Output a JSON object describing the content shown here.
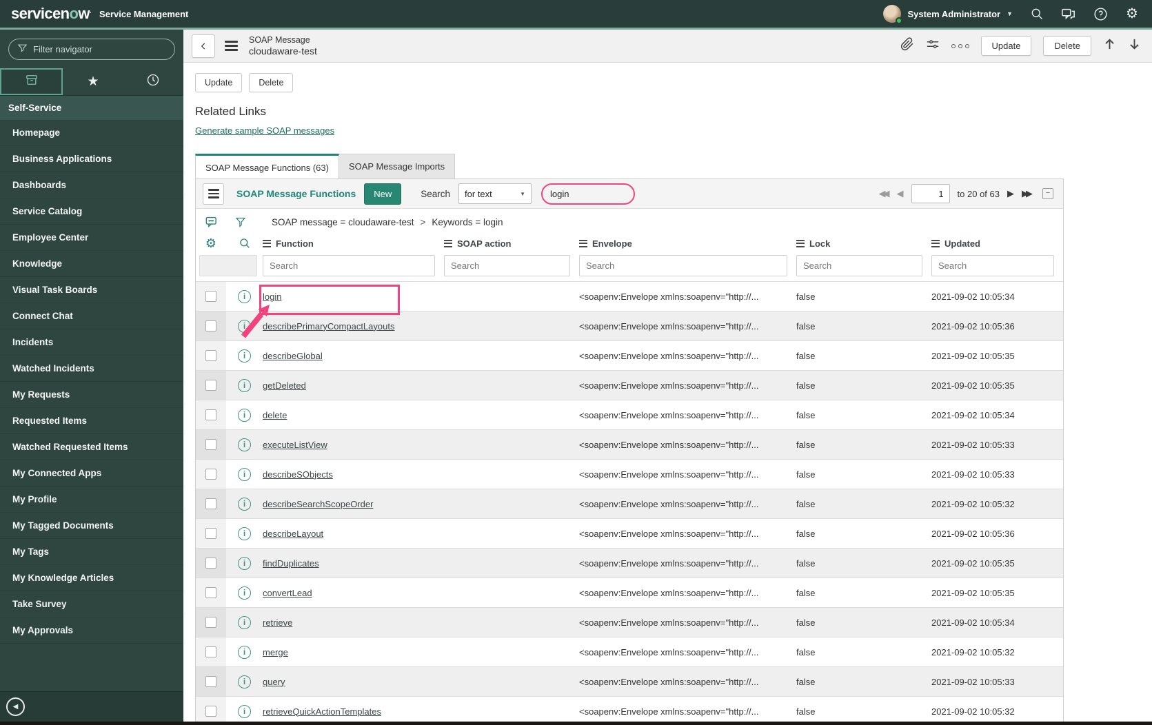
{
  "colors": {
    "banner_bg": "#293E3A",
    "sidebar_bg": "#2E463F",
    "accent_green_line": "#7FA99B",
    "accent_teal": "#278772",
    "link_teal": "#1F6E5E",
    "annotation_pink": "#F0437F",
    "status_green": "#3FBF5A"
  },
  "header": {
    "logo_part1": "servicen",
    "logo_o": "o",
    "logo_part2": "w",
    "app_name": "Service Management",
    "user_name": "System Administrator"
  },
  "sidebar": {
    "filter_placeholder": "Filter navigator",
    "section_label": "Self-Service",
    "items": [
      "Homepage",
      "Business Applications",
      "Dashboards",
      "Service Catalog",
      "Employee Center",
      "Knowledge",
      "Visual Task Boards",
      "Connect Chat",
      "Incidents",
      "Watched Incidents",
      "My Requests",
      "Requested Items",
      "Watched Requested Items",
      "My Connected Apps",
      "My Profile",
      "My Tagged Documents",
      "My Tags",
      "My Knowledge Articles",
      "Take Survey",
      "My Approvals"
    ]
  },
  "form_header": {
    "record_type": "SOAP Message",
    "record_name": "cloudaware-test",
    "update_label": "Update",
    "delete_label": "Delete"
  },
  "related": {
    "update_label": "Update",
    "delete_label": "Delete",
    "title": "Related Links",
    "link": "Generate sample SOAP messages",
    "tabs": [
      {
        "label": "SOAP Message Functions (63)"
      },
      {
        "label": "SOAP Message Imports"
      }
    ]
  },
  "list": {
    "title": "SOAP Message Functions",
    "new_label": "New",
    "search_label": "Search",
    "search_type": "for text",
    "search_value": "login",
    "pagination": {
      "page": "1",
      "range_text": "to 20 of 63"
    },
    "breadcrumb": {
      "part1": "SOAP message = cloudaware-test",
      "separator": ">",
      "part2": "Keywords = login"
    },
    "columns": [
      "Function",
      "SOAP action",
      "Envelope",
      "Lock",
      "Updated"
    ],
    "search_placeholder": "Search",
    "rows": [
      {
        "function": "login",
        "soap_action": "",
        "envelope": "<soapenv:Envelope xmlns:soapenv=\"http://...",
        "lock": "false",
        "updated": "2021-09-02 10:05:34"
      },
      {
        "function": "describePrimaryCompactLayouts",
        "soap_action": "",
        "envelope": "<soapenv:Envelope xmlns:soapenv=\"http://...",
        "lock": "false",
        "updated": "2021-09-02 10:05:36"
      },
      {
        "function": "describeGlobal",
        "soap_action": "",
        "envelope": "<soapenv:Envelope xmlns:soapenv=\"http://...",
        "lock": "false",
        "updated": "2021-09-02 10:05:35"
      },
      {
        "function": "getDeleted",
        "soap_action": "",
        "envelope": "<soapenv:Envelope xmlns:soapenv=\"http://...",
        "lock": "false",
        "updated": "2021-09-02 10:05:35"
      },
      {
        "function": "delete",
        "soap_action": "",
        "envelope": "<soapenv:Envelope xmlns:soapenv=\"http://...",
        "lock": "false",
        "updated": "2021-09-02 10:05:34"
      },
      {
        "function": "executeListView",
        "soap_action": "",
        "envelope": "<soapenv:Envelope xmlns:soapenv=\"http://...",
        "lock": "false",
        "updated": "2021-09-02 10:05:33"
      },
      {
        "function": "describeSObjects",
        "soap_action": "",
        "envelope": "<soapenv:Envelope xmlns:soapenv=\"http://...",
        "lock": "false",
        "updated": "2021-09-02 10:05:33"
      },
      {
        "function": "describeSearchScopeOrder",
        "soap_action": "",
        "envelope": "<soapenv:Envelope xmlns:soapenv=\"http://...",
        "lock": "false",
        "updated": "2021-09-02 10:05:32"
      },
      {
        "function": "describeLayout",
        "soap_action": "",
        "envelope": "<soapenv:Envelope xmlns:soapenv=\"http://...",
        "lock": "false",
        "updated": "2021-09-02 10:05:36"
      },
      {
        "function": "findDuplicates",
        "soap_action": "",
        "envelope": "<soapenv:Envelope xmlns:soapenv=\"http://...",
        "lock": "false",
        "updated": "2021-09-02 10:05:35"
      },
      {
        "function": "convertLead",
        "soap_action": "",
        "envelope": "<soapenv:Envelope xmlns:soapenv=\"http://...",
        "lock": "false",
        "updated": "2021-09-02 10:05:35"
      },
      {
        "function": "retrieve",
        "soap_action": "",
        "envelope": "<soapenv:Envelope xmlns:soapenv=\"http://...",
        "lock": "false",
        "updated": "2021-09-02 10:05:34"
      },
      {
        "function": "merge",
        "soap_action": "",
        "envelope": "<soapenv:Envelope xmlns:soapenv=\"http://...",
        "lock": "false",
        "updated": "2021-09-02 10:05:32"
      },
      {
        "function": "query",
        "soap_action": "",
        "envelope": "<soapenv:Envelope xmlns:soapenv=\"http://...",
        "lock": "false",
        "updated": "2021-09-02 10:05:33"
      },
      {
        "function": "retrieveQuickActionTemplates",
        "soap_action": "",
        "envelope": "<soapenv:Envelope xmlns:soapenv=\"http://...",
        "lock": "false",
        "updated": "2021-09-02 10:05:32"
      }
    ]
  }
}
